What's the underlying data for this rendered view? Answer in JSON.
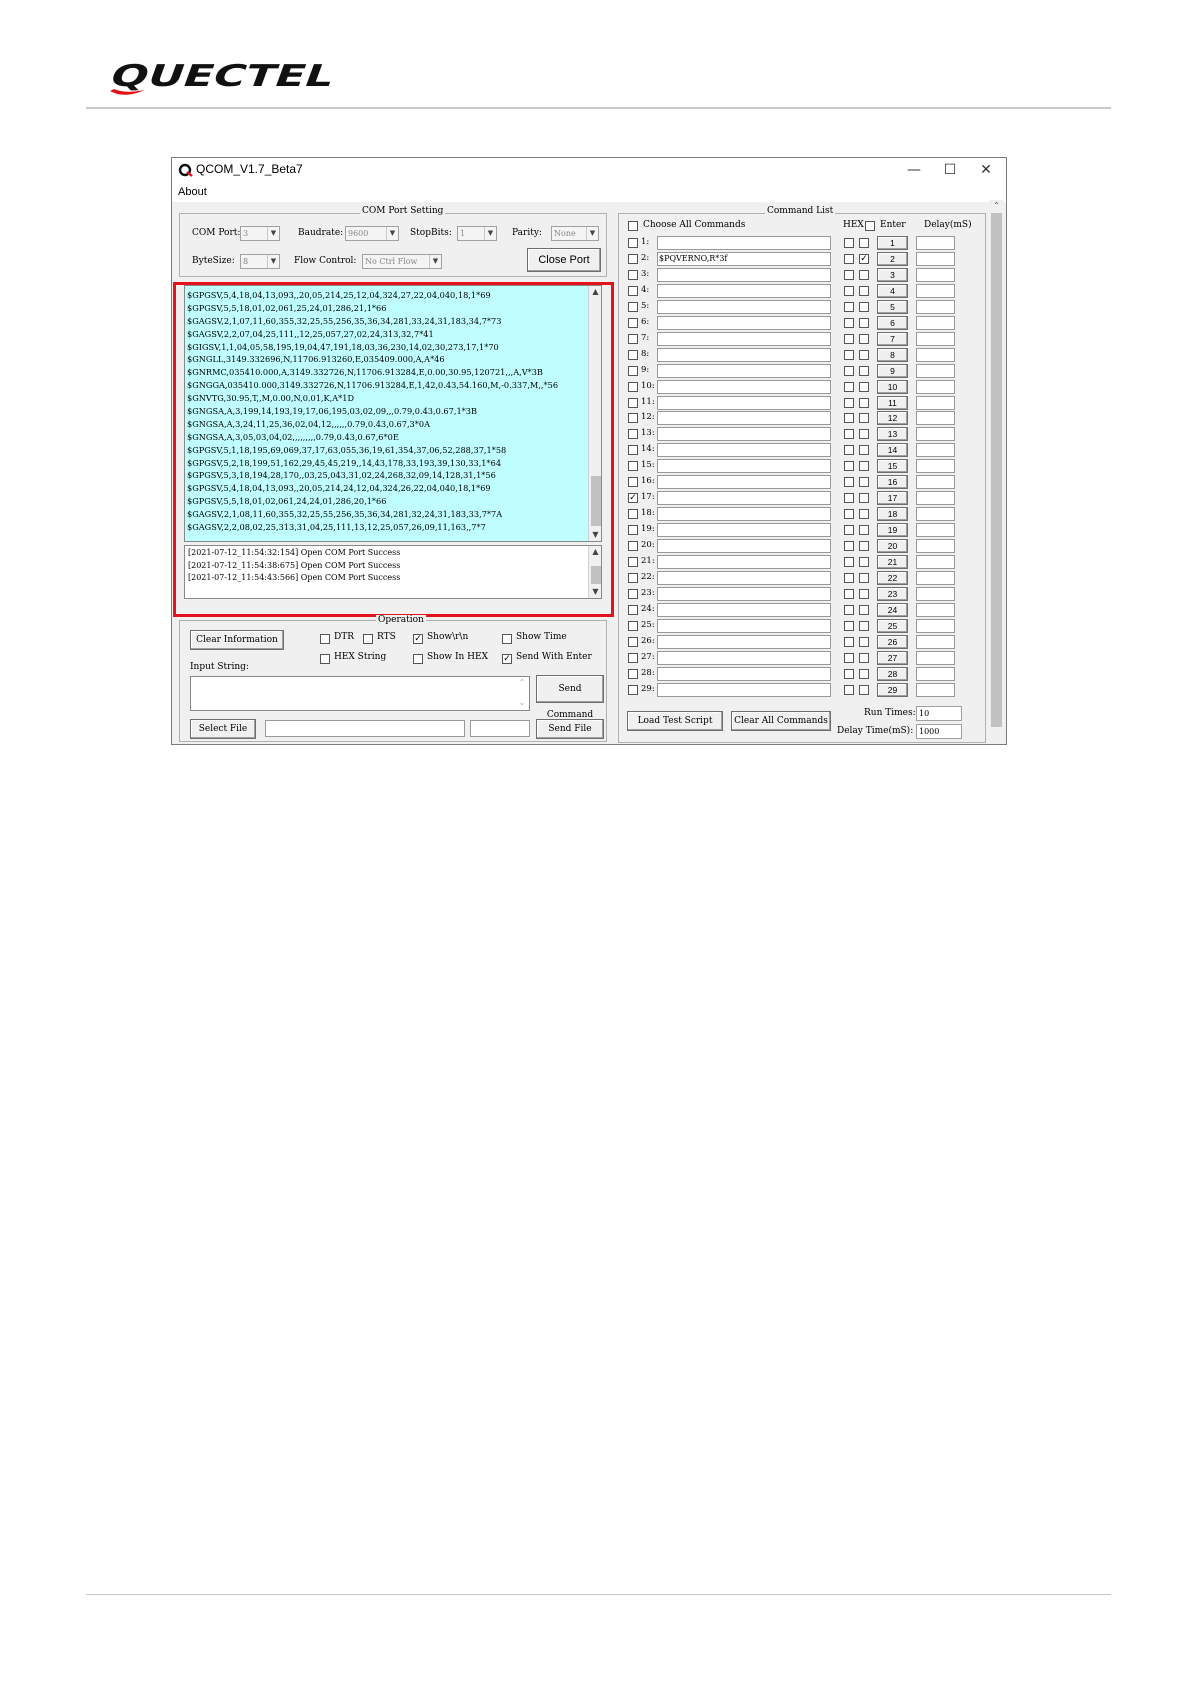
{
  "brand": {
    "logo_text": "QUECTEL",
    "accent": "#e4131b"
  },
  "window": {
    "title": "QCOM_V1.7_Beta7",
    "menu": [
      "About"
    ],
    "minimize_icon": "minimize-icon",
    "maximize_icon": "maximize-icon",
    "close_icon": "close-icon"
  },
  "com_port_setting": {
    "title": "COM Port Setting",
    "com_port": {
      "label": "COM Port:",
      "value": "3"
    },
    "baudrate": {
      "label": "Baudrate:",
      "value": "9600"
    },
    "stopbits": {
      "label": "StopBits:",
      "value": "1"
    },
    "parity": {
      "label": "Parity:",
      "value": "None"
    },
    "bytesize": {
      "label": "ByteSize:",
      "value": "8"
    },
    "flow_control": {
      "label": "Flow Control:",
      "value": "No Ctrl Flow"
    },
    "close_port_label": "Close Port"
  },
  "receive_lines": [
    "$GPGSV,5,4,18,04,13,093,,20,05,214,25,12,04,324,27,22,04,040,18,1*69",
    "$GPGSV,5,5,18,01,02,061,25,24,01,286,21,1*66",
    "$GAGSV,2,1,07,11,60,355,32,25,55,256,35,36,34,281,33,24,31,183,34,7*73",
    "$GAGSV,2,2,07,04,25,111,,12,25,057,27,02,24,313,32,7*41",
    "$GIGSV,1,1,04,05,58,195,19,04,47,191,18,03,36,230,14,02,30,273,17,1*70",
    "$GNGLL,3149.332696,N,11706.913260,E,035409.000,A,A*46",
    "$GNRMC,035410.000,A,3149.332726,N,11706.913284,E,0.00,30.95,120721,,,A,V*3B",
    "$GNGGA,035410.000,3149.332726,N,11706.913284,E,1,42,0.43,54.160,M,-0.337,M,,*56",
    "$GNVTG,30.95,T,,M,0.00,N,0.01,K,A*1D",
    "$GNGSA,A,3,199,14,193,19,17,06,195,03,02,09,,,0.79,0.43,0.67,1*3B",
    "$GNGSA,A,3,24,11,25,36,02,04,12,,,,,,0.79,0.43,0.67,3*0A",
    "$GNGSA,A,3,05,03,04,02,,,,,,,,,0.79,0.43,0.67,6*0E",
    "$GPGSV,5,1,18,195,69,069,37,17,63,055,36,19,61,354,37,06,52,288,37,1*58",
    "$GPGSV,5,2,18,199,51,162,29,45,45,219,,14,43,178,33,193,39,130,33,1*64",
    "$GPGSV,5,3,18,194,28,170,,03,25,043,31,02,24,268,32,09,14,128,31,1*56",
    "$GPGSV,5,4,18,04,13,093,,20,05,214,24,12,04,324,26,22,04,040,18,1*69",
    "$GPGSV,5,5,18,01,02,061,24,24,01,286,20,1*66",
    "$GAGSV,2,1,08,11,60,355,32,25,55,256,35,36,34,281,32,24,31,183,33,7*7A",
    "$GAGSV,2,2,08,02,25,313,31,04,25,111,13,12,25,057,26,09,11,163,,7*7"
  ],
  "log_lines": [
    "[2021-07-12_11:54:32:154] Open COM Port Success",
    "[2021-07-12_11:54:38:675] Open COM Port Success",
    "[2021-07-12_11:54:43:566] Open COM Port Success"
  ],
  "operation": {
    "title": "Operation",
    "clear_information": "Clear Information",
    "dtr": {
      "label": "DTR",
      "checked": false
    },
    "rts": {
      "label": "RTS",
      "checked": false
    },
    "show_rn": {
      "label": "Show\\r\\n",
      "checked": true
    },
    "show_time": {
      "label": "Show Time",
      "checked": false
    },
    "hex_string": {
      "label": "HEX String",
      "checked": false
    },
    "show_in_hex": {
      "label": "Show In HEX",
      "checked": false
    },
    "send_with_enter": {
      "label": "Send With Enter",
      "checked": true
    },
    "input_string_label": "Input String:",
    "send_command": "Send Command",
    "select_file": "Select File",
    "send_file": "Send File"
  },
  "command_list": {
    "title": "Command List",
    "choose_all": "Choose All Commands",
    "hex_header": "HEX",
    "enter_header": "Enter",
    "delay_header": "Delay(mS)",
    "rows": [
      {
        "num": "1:",
        "button": "1",
        "command": "",
        "checked": false,
        "enter": false
      },
      {
        "num": "2:",
        "button": "2",
        "command": "$PQVERNO,R*3f",
        "checked": false,
        "enter": true
      },
      {
        "num": "3:",
        "button": "3",
        "command": "",
        "checked": false,
        "enter": false
      },
      {
        "num": "4:",
        "button": "4",
        "command": "",
        "checked": false,
        "enter": false
      },
      {
        "num": "5:",
        "button": "5",
        "command": "",
        "checked": false,
        "enter": false
      },
      {
        "num": "6:",
        "button": "6",
        "command": "",
        "checked": false,
        "enter": false
      },
      {
        "num": "7:",
        "button": "7",
        "command": "",
        "checked": false,
        "enter": false
      },
      {
        "num": "8:",
        "button": "8",
        "command": "",
        "checked": false,
        "enter": false
      },
      {
        "num": "9:",
        "button": "9",
        "command": "",
        "checked": false,
        "enter": false
      },
      {
        "num": "10:",
        "button": "10",
        "command": "",
        "checked": false,
        "enter": false
      },
      {
        "num": "11:",
        "button": "11",
        "command": "",
        "checked": false,
        "enter": false
      },
      {
        "num": "12:",
        "button": "12",
        "command": "",
        "checked": false,
        "enter": false
      },
      {
        "num": "13:",
        "button": "13",
        "command": "",
        "checked": false,
        "enter": false
      },
      {
        "num": "14:",
        "button": "14",
        "command": "",
        "checked": false,
        "enter": false
      },
      {
        "num": "15:",
        "button": "15",
        "command": "",
        "checked": false,
        "enter": false
      },
      {
        "num": "16:",
        "button": "16",
        "command": "",
        "checked": false,
        "enter": false
      },
      {
        "num": "17:",
        "button": "17",
        "command": "",
        "checked": true,
        "enter": false
      },
      {
        "num": "18:",
        "button": "18",
        "command": "",
        "checked": false,
        "enter": false
      },
      {
        "num": "19:",
        "button": "19",
        "command": "",
        "checked": false,
        "enter": false
      },
      {
        "num": "20:",
        "button": "20",
        "command": "",
        "checked": false,
        "enter": false
      },
      {
        "num": "21:",
        "button": "21",
        "command": "",
        "checked": false,
        "enter": false
      },
      {
        "num": "22:",
        "button": "22",
        "command": "",
        "checked": false,
        "enter": false
      },
      {
        "num": "23:",
        "button": "23",
        "command": "",
        "checked": false,
        "enter": false
      },
      {
        "num": "24:",
        "button": "24",
        "command": "",
        "checked": false,
        "enter": false
      },
      {
        "num": "25:",
        "button": "25",
        "command": "",
        "checked": false,
        "enter": false
      },
      {
        "num": "26:",
        "button": "26",
        "command": "",
        "checked": false,
        "enter": false
      },
      {
        "num": "27:",
        "button": "27",
        "command": "",
        "checked": false,
        "enter": false
      },
      {
        "num": "28:",
        "button": "28",
        "command": "",
        "checked": false,
        "enter": false
      },
      {
        "num": "29:",
        "button": "29",
        "command": "",
        "checked": false,
        "enter": false
      }
    ],
    "load_test_script": "Load Test Script",
    "clear_all_commands": "Clear All Commands",
    "run_times": {
      "label": "Run Times:",
      "value": "10"
    },
    "delay_time": {
      "label": "Delay Time(mS):",
      "value": "1000"
    }
  }
}
